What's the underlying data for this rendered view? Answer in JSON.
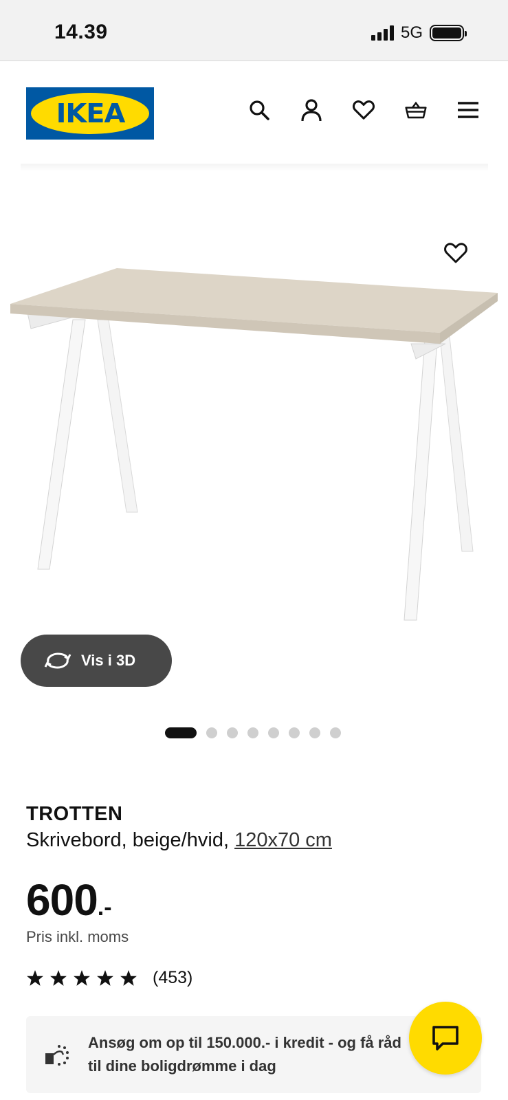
{
  "status_bar": {
    "time": "14.39",
    "network": "5G"
  },
  "header": {
    "logo_text": "IKEA",
    "icons": [
      "search-icon",
      "profile-icon",
      "heart-icon",
      "basket-icon",
      "menu-icon"
    ]
  },
  "gallery": {
    "view_3d_label": "Vis i 3D",
    "total_images": 8,
    "active_index": 0
  },
  "product": {
    "name": "TROTTEN",
    "description": "Skrivebord, beige/hvid,",
    "size_link": "120x70 cm",
    "price_integer": "600",
    "price_suffix": ".-",
    "price_note": "Pris inkl. moms",
    "rating_stars": 5,
    "rating_count": "(453)"
  },
  "credit_banner": {
    "text": "Ansøg om op til 150.000.- i kredit - og få råd til dine boligdrømme i dag"
  },
  "colors": {
    "ikea_blue": "#0058a3",
    "ikea_yellow": "#ffdb00",
    "pill_dark": "#484848",
    "desk_top": "#ddd5c7"
  }
}
